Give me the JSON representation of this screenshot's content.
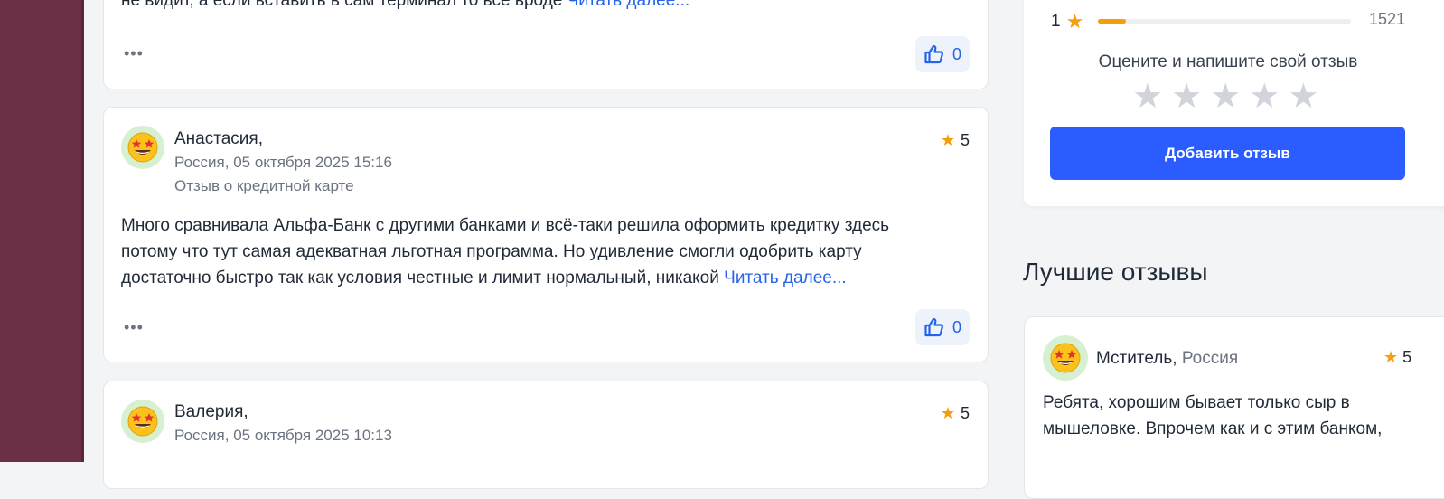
{
  "reviews": [
    {
      "text": "не видит, а если вставить в сам терминал то все вроде",
      "read_more": "Читать далее...",
      "likes": "0"
    },
    {
      "author": "Анастасия,",
      "location_date": "Россия, 05 октября 2025 15:16",
      "category": "Отзыв о кредитной карте",
      "rating": "5",
      "text": "Много сравнивала Альфа-Банк с другими банками и всё-таки решила оформить кредитку здесь потому что тут самая адекватная льготная программа. Но удивление смогли одобрить карту достаточно быстро так как условия честные и лимит нормальный, никакой",
      "read_more": "Читать далее...",
      "likes": "0"
    },
    {
      "author": "Валерия,",
      "location_date": "Россия, 05 октября 2025 10:13",
      "rating": "5"
    }
  ],
  "summary": {
    "distribution": {
      "stars": "1",
      "count": "1521",
      "fill_fraction": 0.11
    },
    "rate_prompt": "Оцените и напишите свой отзыв",
    "add_button": "Добавить отзыв"
  },
  "best_reviews": {
    "title": "Лучшие отзывы",
    "item": {
      "author": "Мститель,",
      "country": "Россия",
      "rating": "5",
      "text": "Ребята, хорошим бывает только сыр в мышеловке. Впрочем как и с этим банком,"
    }
  },
  "icons": {
    "more": "more-dots-icon",
    "like": "thumbs-up-icon",
    "star": "star-icon",
    "avatar": "star-struck-emoji-avatar"
  },
  "colors": {
    "accent_blue": "#2a5cff",
    "link_blue": "#2563eb",
    "star_gold": "#f59e0b",
    "sidebar_maroon": "#6b2f46"
  }
}
